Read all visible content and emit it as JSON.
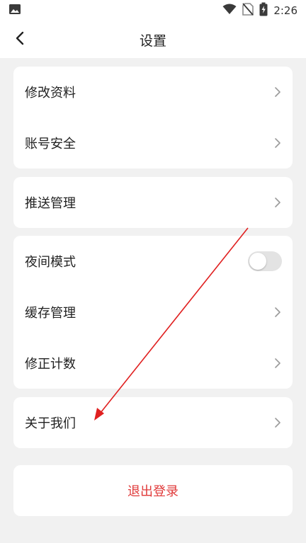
{
  "status_bar": {
    "time": "2:26",
    "icons": [
      "gallery-icon",
      "wifi-icon",
      "no-sim-icon",
      "battery-charging-icon"
    ]
  },
  "header": {
    "title": "设置",
    "back_icon": "chevron-left-icon"
  },
  "groups": [
    {
      "items": [
        {
          "label": "修改资料"
        },
        {
          "label": "账号安全"
        }
      ]
    },
    {
      "items": [
        {
          "label": "推送管理"
        }
      ]
    },
    {
      "items": [
        {
          "label": "夜间模式",
          "toggle": false
        },
        {
          "label": "缓存管理"
        },
        {
          "label": "修正计数"
        }
      ]
    },
    {
      "items": [
        {
          "label": "关于我们"
        }
      ]
    }
  ],
  "logout": {
    "label": "退出登录"
  },
  "colors": {
    "background": "#f1f1f1",
    "card": "#ffffff",
    "logout_text": "#e03a3a",
    "annotation_arrow": "#e02020"
  }
}
